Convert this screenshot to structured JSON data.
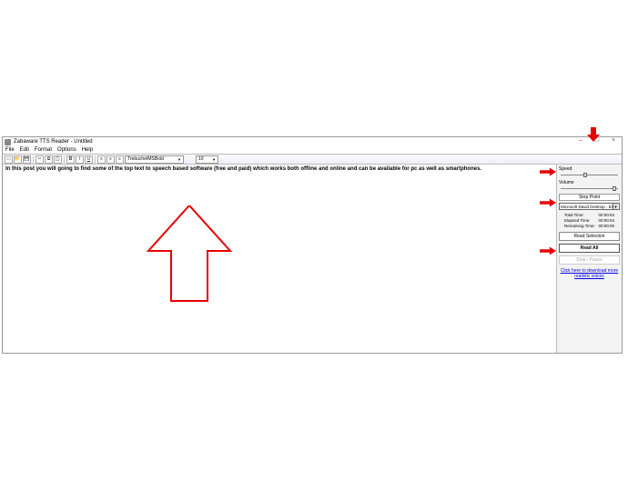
{
  "titlebar": {
    "app_title": "Zabaware TTS Reader - Untitled"
  },
  "menubar": {
    "file": "File",
    "edit": "Edit",
    "format": "Format",
    "options": "Options",
    "help": "Help"
  },
  "toolbar": {
    "font_name": "TrebuchetMSBold",
    "font_size": "10"
  },
  "document": {
    "body_text": "In this post you will going to find some of the top text to speech based software (free and paid) which works both offline and online and can be available for pc as well as smartphones."
  },
  "sidebar": {
    "speed_label": "Speed",
    "volume_label": "Volume",
    "stop_point_label": "Stop Point",
    "voice_selected": "Microsoft David Desktop - English",
    "total_time_label": "Total Time:",
    "total_time_value": "00:00:04",
    "elapsed_time_label": "Elapsed Time:",
    "elapsed_time_value": "00:00:04",
    "remaining_time_label": "Remaining Time:",
    "remaining_time_value": "00:00:00",
    "read_selection_label": "Read Selection",
    "read_all_label": "Read All",
    "stop_pause_label": "Stop / Pause",
    "download_link": "Click here to download more realistic voices"
  },
  "win_controls": {
    "min": "–",
    "max": "□",
    "close": "×"
  }
}
